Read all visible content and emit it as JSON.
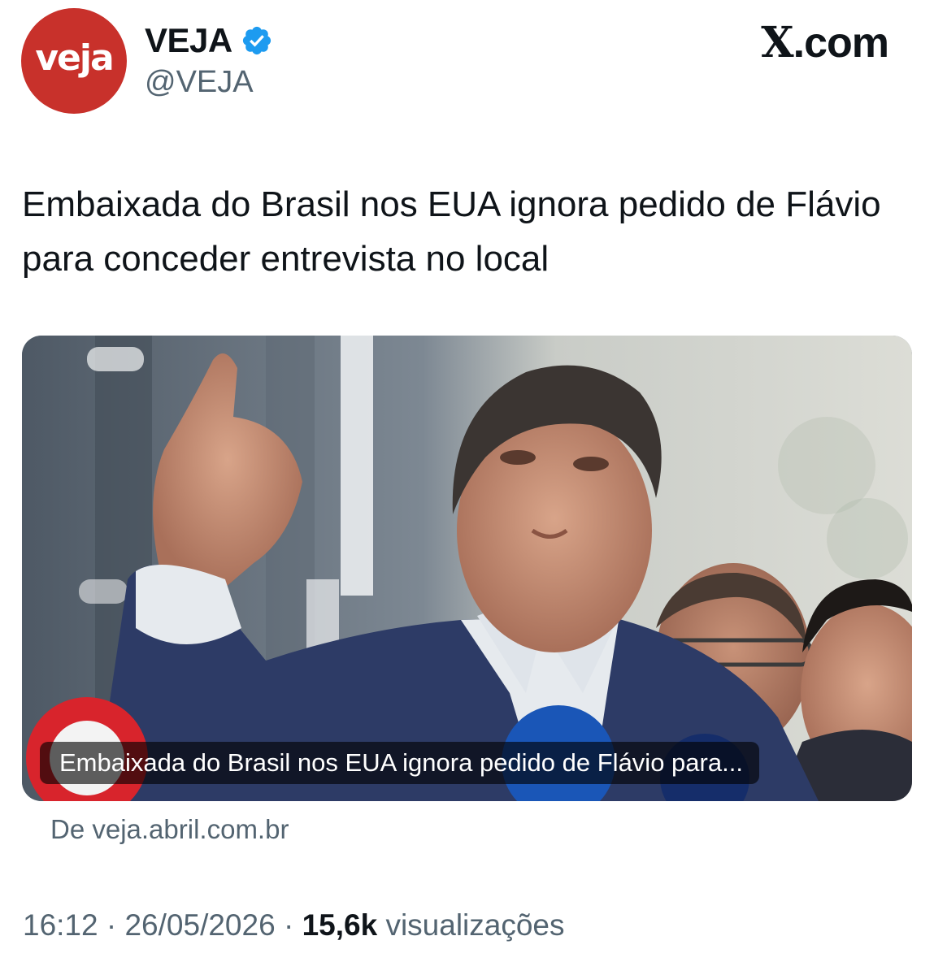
{
  "author": {
    "avatar_text": "veja",
    "display_name": "VEJA",
    "handle": "@VEJA",
    "verified": true,
    "avatar_color": "#c8312b",
    "verified_color": "#1d9bf0"
  },
  "brand": {
    "x_letter": "X",
    "domain": ".com"
  },
  "tweet": {
    "text": "Embaixada do Brasil nos EUA ignora pedido de Flávio para conceder entrevista no local"
  },
  "link_card": {
    "caption": "Embaixada do Brasil nos EUA ignora pedido de Flávio para...",
    "source": "De veja.abril.com.br"
  },
  "meta": {
    "time": "16:12",
    "separator": "·",
    "date": "26/05/2026",
    "views_count": "15,6k",
    "views_label": "visualizações"
  }
}
